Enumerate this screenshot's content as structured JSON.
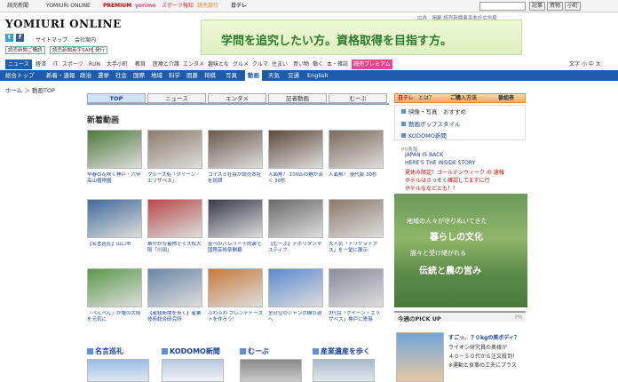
{
  "topbar": {
    "links": [
      "読売新聞",
      "YOMIURI ONLINE",
      "PREMIUM",
      "yorimo",
      "スポーツ報知",
      "読売旅行",
      "日テレ"
    ],
    "buttons": [
      "記事",
      "買物",
      "小町"
    ]
  },
  "header": {
    "logo": "YOMIURI ONLINE",
    "site_links": [
      "サイトマップ",
      "会社案内"
    ],
    "sub_buttons": [
      "読売新聞ご購読",
      "読売新聞英字SAPIX",
      "発行"
    ],
    "ad_header": "広告　掲載 読売新聞東京本社広告局",
    "banner_text": "学問を追究したい方。資格取得を目指す方。"
  },
  "nav1": {
    "items": [
      "ニュース",
      "経済",
      "IT",
      "スポーツ",
      "RUN",
      "大手小町",
      "教育",
      "医療と介護",
      "エンタメ",
      "趣味とな",
      "グルメ",
      "クルマ",
      "住まい",
      "買い物",
      "働く",
      "本・雑誌",
      "読売プレミアム"
    ],
    "font_label": "文字",
    "font_sizes": [
      "小",
      "中",
      "大"
    ]
  },
  "nav2": {
    "items": [
      "総合トップ",
      "新着・速報",
      "政治",
      "選挙",
      "社会",
      "国際",
      "地域",
      "科学",
      "囲碁",
      "将棋",
      "写真",
      "動画",
      "天気",
      "交通",
      "English"
    ],
    "active": "動画"
  },
  "breadcrumb": {
    "home": "ホーム",
    "sep": "＞",
    "current": "動画TOP"
  },
  "tabs": [
    "TOP",
    "ニュース",
    "エンタメ",
    "記者動画",
    "むーぶ"
  ],
  "section": {
    "title": "新着動画"
  },
  "videos": [
    {
      "caption": "早春の花咲く神戸・六甲高山植物園",
      "color": "#4f7a3c"
    },
    {
      "caption": "クルーズ船「クイーン・エリザベス」",
      "color": "#8b7d6b"
    },
    {
      "caption": "コイズミ社長が読売本社を訪問",
      "color": "#6a5a4c"
    },
    {
      "caption": "人面魚？ 100匹の鯉が泳ぐ 30秒",
      "color": "#5e4a3a"
    },
    {
      "caption": "人面魚？ 現代版 30秒",
      "color": "#7a6a5a"
    },
    {
      "caption": "【名言巡礼】山口市",
      "color": "#3f6a9a"
    },
    {
      "caption": "華やかな着物でミス松大阪「川田」",
      "color": "#b84a4a"
    },
    {
      "caption": "金ペのバレリーナ的装で国際芸術祭開幕",
      "color": "#3a3a4a"
    },
    {
      "caption": "【むーぶ】ナポリタンマスティフ",
      "color": "#6a6a6a"
    },
    {
      "caption": "大人気「トリケラトプス」を一堂に展示",
      "color": "#8a7a6a"
    },
    {
      "caption": "「ぺんぺん」が電の大阪を元気に",
      "color": "#5a9a4a"
    },
    {
      "caption": "【産経新聞を歩く】産業技術総合研究所",
      "color": "#6a86a8"
    },
    {
      "caption": "ふわふわ フレンチトーストを作ろう！",
      "color": "#c87a3a"
    },
    {
      "caption": "全日空のジャンボ機引退へ",
      "color": "#5a8acf"
    },
    {
      "caption": "3代目「クイーン・エリザベス」神戸に寄港",
      "color": "#8a8a9a"
    }
  ],
  "bottom_sections": [
    "名言巡礼",
    "KODOMO新聞",
    "むーぶ",
    "産業遺産を歩く"
  ],
  "side": {
    "bar_left": "日テレ",
    "bar_mid": "ご購入方法",
    "bar_right": "番組表",
    "bar_q": "とは？",
    "links": [
      "映像・写真　おすすめ",
      "動画ポップスタイル",
      "KODOMO新聞"
    ],
    "pr_label": "PR情報",
    "pr_lines": [
      "JAPAN IS BACK",
      "HERE'S THE INSIDE STORY",
      "夏休み限定！ゴールデンウィーク の 速報",
      "ホテルはさっそく確認してますに行",
      "ホテルななどとも！！"
    ],
    "ad_lines": [
      "地域の人々が守りぬいてきた",
      "暮らしの文化",
      "脈々と受け継がれる",
      "伝統と農の営み"
    ],
    "pick_label": "今週のPICK UP",
    "pick_pr": "PR",
    "pick_lines": [
      "すごっ、７０kgの美ボディ？",
      "ライオン研究員の奥様が",
      "４０－５０代から注文殺到！",
      "※運動と食事の工夫にプラス"
    ]
  }
}
